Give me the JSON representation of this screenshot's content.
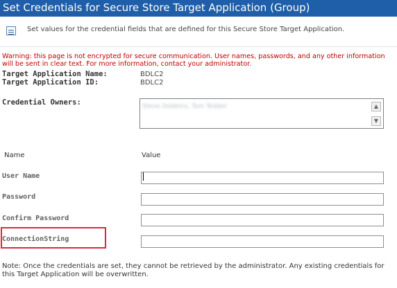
{
  "title": "Set Credentials for Secure Store Target Application (Group)",
  "description": "Set values for the credential fields that are defined for this Secure Store Target Application.",
  "warning": "Warning: this page is not encrypted for secure communication. User names, passwords, and any other information will be sent in clear text. For more information, contact your administrator.",
  "target_application": {
    "name_label": "Target Application Name:",
    "name_value": "BDLC2",
    "id_label": "Target Application ID:",
    "id_value": "BDLC2"
  },
  "credential_owners": {
    "label": "Credential Owners:",
    "value": "Steve Dobbins, Tom Tedder"
  },
  "columns": {
    "name": "Name",
    "value": "Value"
  },
  "fields": [
    {
      "label": "User Name",
      "value": ""
    },
    {
      "label": "Password",
      "value": ""
    },
    {
      "label": "Confirm Password",
      "value": ""
    },
    {
      "label": "ConnectionString",
      "value": ""
    }
  ],
  "note": "Note: Once the credentials are set, they cannot be retrieved by the administrator. Any existing credentials for this Target Application will be overwritten.",
  "icons": {
    "description": "document-list-icon",
    "scroll_up": "scroll-up-icon",
    "scroll_down": "scroll-down-icon"
  },
  "colors": {
    "title_bar": "#1f5ea8",
    "warning": "#c00000",
    "highlight": "#d62c35"
  }
}
